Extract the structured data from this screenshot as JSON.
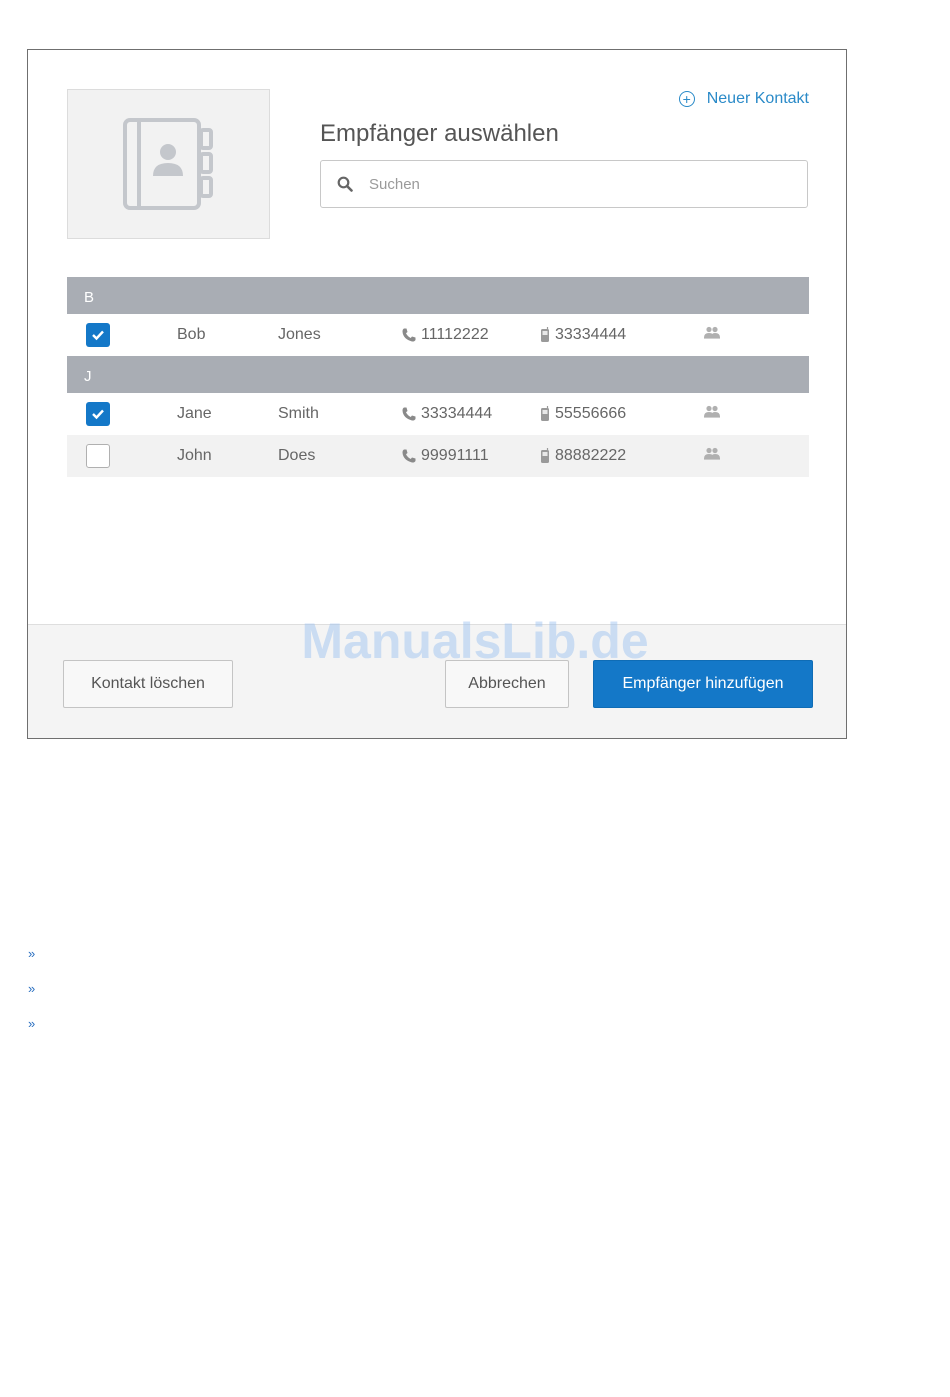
{
  "dialog": {
    "title": "Empfänger auswählen",
    "new_contact_label": "Neuer Kontakt",
    "search": {
      "placeholder": "Suchen",
      "value": ""
    }
  },
  "groups": [
    {
      "letter": "B",
      "contacts": [
        {
          "first": "Bob",
          "last": "Jones",
          "phone": "11112222",
          "mobile": "33334444",
          "checked": true
        }
      ]
    },
    {
      "letter": "J",
      "contacts": [
        {
          "first": "Jane",
          "last": "Smith",
          "phone": "33334444",
          "mobile": "55556666",
          "checked": true
        },
        {
          "first": "John",
          "last": "Does",
          "phone": "99991111",
          "mobile": "88882222",
          "checked": false
        }
      ]
    }
  ],
  "footer": {
    "delete_label": "Kontakt löschen",
    "cancel_label": "Abbrechen",
    "add_label": "Empfänger hinzufügen"
  },
  "watermark": "ManualsLib.de",
  "bullets": [
    "»",
    "»",
    "»"
  ],
  "colors": {
    "accent": "#1478c8",
    "link": "#2a8ac8",
    "group_header": "#a9adb4"
  },
  "icons": {
    "avatar": "address-book-icon",
    "search": "search-icon",
    "phone": "phone-icon",
    "mobile": "mobile-icon",
    "group": "group-icon"
  }
}
